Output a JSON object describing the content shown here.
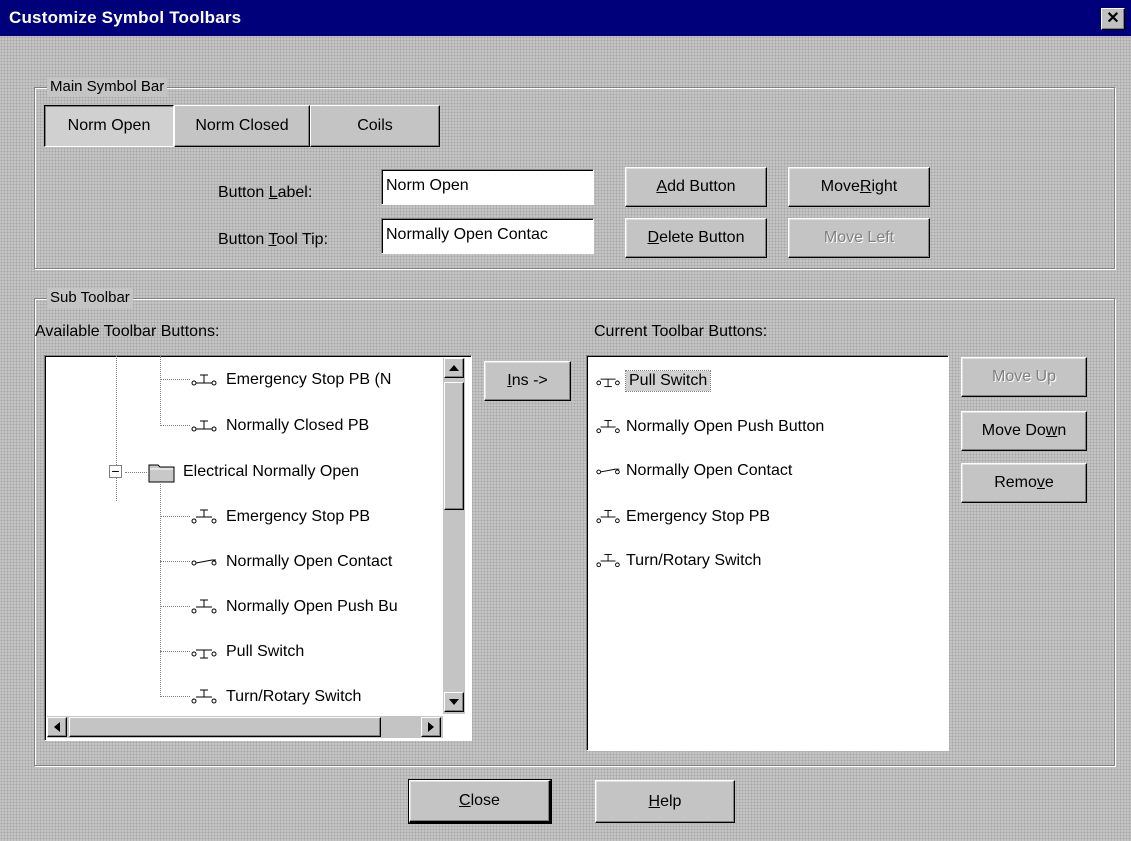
{
  "window": {
    "title": "Customize Symbol Toolbars",
    "close_glyph": "✕"
  },
  "main_symbol_bar": {
    "legend": "Main Symbol Bar",
    "tabs": [
      {
        "label": "Norm Open",
        "active": true
      },
      {
        "label": "Norm Closed",
        "active": false
      },
      {
        "label": "Coils",
        "active": false
      }
    ],
    "button_label": {
      "label_pre": "Button ",
      "label_key": "L",
      "label_post": "abel:",
      "value": "Norm Open"
    },
    "button_tooltip": {
      "label_pre": "Button ",
      "label_key": "T",
      "label_post": "ool Tip:",
      "value": "Normally Open Contac"
    },
    "add_button": {
      "key": "A",
      "rest": "dd Button"
    },
    "delete_button": {
      "key": "D",
      "rest": "elete Button"
    },
    "move_right": {
      "pre": "Move ",
      "key": "R",
      "rest": "ight"
    },
    "move_left": {
      "label": "Move Left",
      "disabled": true
    }
  },
  "sub_toolbar": {
    "legend": "Sub Toolbar",
    "available_label": "Available Toolbar Buttons:",
    "current_label": "Current Toolbar Buttons:",
    "available_items": [
      {
        "label": "Emergency Stop PB (N",
        "icon": "normally-closed-pb-icon"
      },
      {
        "label": "Normally Closed PB",
        "icon": "normally-closed-pb-icon"
      },
      {
        "label": "Electrical Normally Open",
        "icon": "folder-icon",
        "is_folder": true,
        "expander": "−"
      },
      {
        "label": "Emergency Stop PB",
        "icon": "normally-open-pb-icon"
      },
      {
        "label": "Normally Open Contact",
        "icon": "normally-open-contact-icon"
      },
      {
        "label": "Normally Open Push Bu",
        "icon": "normally-open-pb-icon"
      },
      {
        "label": "Pull Switch",
        "icon": "pull-switch-icon"
      },
      {
        "label": "Turn/Rotary Switch",
        "icon": "normally-open-pb-icon"
      }
    ],
    "insert_button": {
      "key": "I",
      "rest": "ns ->"
    },
    "current_items": [
      {
        "label": "Pull Switch",
        "icon": "pull-switch-icon",
        "selected": true
      },
      {
        "label": "Normally Open Push Button",
        "icon": "normally-open-pb-icon"
      },
      {
        "label": "Normally Open Contact",
        "icon": "normally-open-contact-icon"
      },
      {
        "label": "Emergency Stop PB",
        "icon": "normally-open-pb-icon"
      },
      {
        "label": "Turn/Rotary Switch",
        "icon": "normally-open-pb-icon"
      }
    ],
    "move_up": {
      "label": "Move Up",
      "disabled": true
    },
    "move_down": {
      "pre": "Move Do",
      "key": "w",
      "rest": "n"
    },
    "remove": {
      "pre": "Remo",
      "key": "v",
      "rest": "e"
    }
  },
  "footer": {
    "close": {
      "key": "C",
      "rest": "lose"
    },
    "help": {
      "key": "H",
      "rest": "elp"
    }
  }
}
